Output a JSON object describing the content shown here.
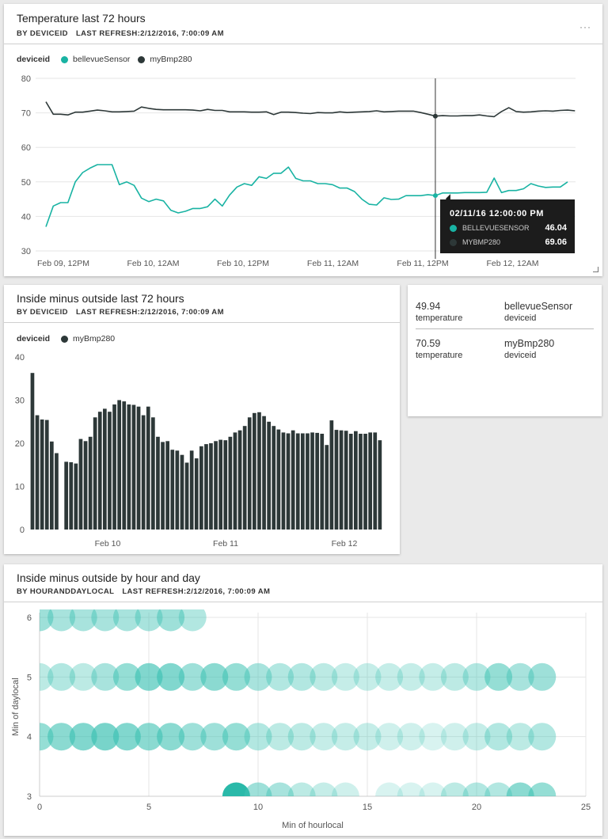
{
  "colors": {
    "teal": "#19b3a3",
    "dark": "#2d3838",
    "bubble": "#3ec2b3"
  },
  "tile1": {
    "title": "Temperature last 72 hours",
    "by": "BY DEVICEID",
    "refresh": "LAST REFRESH:2/12/2016, 7:00:09 AM",
    "more_icon": "···",
    "legend_label": "deviceid",
    "legend_items": [
      "bellevueSensor",
      "myBmp280"
    ],
    "tooltip": {
      "title": "02/11/16 12:00:00 PM",
      "rows": [
        {
          "name": "BELLEVUESENSOR",
          "value": "46.04"
        },
        {
          "name": "MYBMP280",
          "value": "69.06"
        }
      ]
    }
  },
  "tile2": {
    "title": "Inside minus outside last 72 hours",
    "by": "BY DEVICEID",
    "refresh": "LAST REFRESH:2/12/2016, 7:00:09 AM",
    "legend_label": "deviceid",
    "legend_items": [
      "myBmp280"
    ]
  },
  "tile3": {
    "rows": [
      {
        "value": "49.94",
        "value_label": "temperature",
        "name": "bellevueSensor",
        "name_label": "deviceid"
      },
      {
        "value": "70.59",
        "value_label": "temperature",
        "name": "myBmp280",
        "name_label": "deviceid"
      }
    ]
  },
  "tile4": {
    "title": "Inside minus outside by hour and day",
    "by": "BY HOURANDDAYLOCAL",
    "refresh": "LAST REFRESH:2/12/2016, 7:00:09 AM"
  },
  "chart_data": [
    {
      "type": "line",
      "title": "Temperature last 72 hours",
      "xlabel": "",
      "ylabel": "",
      "ylim": [
        30,
        80
      ],
      "yticks": [
        30,
        40,
        50,
        60,
        70,
        80
      ],
      "x_tick_labels": [
        "Feb 09, 12PM",
        "Feb 10, 12AM",
        "Feb 10, 12PM",
        "Feb 11, 12AM",
        "Feb 11, 12PM",
        "Feb 12, 12AM"
      ],
      "grid": true,
      "hover_index": 53,
      "series": [
        {
          "name": "bellevueSensor",
          "values": [
            37,
            43,
            44,
            44,
            50,
            52.7,
            54,
            55,
            55,
            55,
            49.2,
            50,
            49,
            45.3,
            44.3,
            45,
            44.5,
            41.8,
            41,
            41.5,
            42.3,
            42.3,
            42.8,
            45,
            43,
            46.2,
            48.5,
            49.5,
            49,
            51.5,
            51,
            52.5,
            52.5,
            54.3,
            51,
            50.3,
            50.3,
            49.5,
            49.5,
            49.2,
            48.2,
            48.2,
            47.2,
            45,
            43.5,
            43.3,
            45.4,
            44.9,
            45,
            46,
            46,
            46,
            46.3,
            46.04,
            46.8,
            46.8,
            46.8,
            46.9,
            46.9,
            46.9,
            47,
            51.1,
            46.9,
            47.5,
            47.5,
            48,
            49.5,
            48.8,
            48.4,
            48.5,
            48.5,
            50
          ]
        },
        {
          "name": "myBmp280",
          "values": [
            73.2,
            69.6,
            69.6,
            69.4,
            70.2,
            70.2,
            70.5,
            70.8,
            70.6,
            70.3,
            70.3,
            70.4,
            70.5,
            71.7,
            71.3,
            71,
            70.9,
            70.9,
            70.9,
            70.9,
            70.8,
            70.6,
            71,
            70.7,
            70.7,
            70.3,
            70.3,
            70.3,
            70.2,
            70.2,
            70.3,
            69.5,
            70.2,
            70.2,
            70.1,
            69.9,
            69.8,
            70.1,
            70,
            70,
            70.3,
            70.1,
            70.2,
            70.3,
            70.4,
            70.6,
            70.3,
            70.4,
            70.5,
            70.5,
            70.5,
            70.1,
            69.6,
            69.06,
            69.2,
            69.1,
            69.1,
            69.2,
            69.2,
            69.4,
            69.1,
            68.9,
            70.4,
            71.5,
            70.4,
            70.2,
            70.3,
            70.5,
            70.6,
            70.5,
            70.7,
            70.8,
            70.6
          ]
        }
      ]
    },
    {
      "type": "bar",
      "title": "Inside minus outside last 72 hours",
      "xlabel": "",
      "ylabel": "",
      "ylim": [
        0,
        40
      ],
      "yticks": [
        0,
        10,
        20,
        30,
        40
      ],
      "x_tick_labels": [
        "Feb 10",
        "Feb 11",
        "Feb 12"
      ],
      "series": [
        {
          "name": "myBmp280",
          "values": [
            36.3,
            26.5,
            25.5,
            25.4,
            20.4,
            17.7,
            null,
            15.7,
            15.6,
            15.3,
            21,
            20.5,
            21.5,
            26,
            27.3,
            28,
            27.3,
            29,
            30,
            29.7,
            29,
            28.9,
            28.5,
            26.5,
            28.5,
            26,
            21.5,
            20.3,
            20.5,
            18.5,
            18.3,
            17.3,
            15.5,
            18.3,
            16.5,
            19.3,
            19.8,
            20,
            20.5,
            20.8,
            20.7,
            21.5,
            22.5,
            23,
            24,
            26,
            27,
            27.2,
            26.3,
            25,
            24,
            23.2,
            22.5,
            22.3,
            23,
            22.3,
            22.3,
            22.3,
            22.5,
            22.4,
            22.2,
            19.6,
            25.3,
            23.1,
            23,
            22.9,
            22.2,
            22.8,
            22.2,
            22.2,
            22.5,
            22.5,
            20.7
          ]
        }
      ]
    },
    {
      "type": "scatter",
      "title": "",
      "xlabel": "Min of hourlocal",
      "ylabel": "Min of daylocal",
      "xlim": [
        0,
        25
      ],
      "ylim": [
        3,
        6
      ],
      "xticks": [
        0,
        5,
        10,
        15,
        20,
        25
      ],
      "yticks": [
        3,
        4,
        5,
        6
      ],
      "grid": true,
      "points": [
        {
          "x": 0,
          "y": 6,
          "o": 0.5
        },
        {
          "x": 1,
          "y": 6,
          "o": 0.45
        },
        {
          "x": 2,
          "y": 6,
          "o": 0.45
        },
        {
          "x": 3,
          "y": 6,
          "o": 0.45
        },
        {
          "x": 4,
          "y": 6,
          "o": 0.45
        },
        {
          "x": 5,
          "y": 6,
          "o": 0.45
        },
        {
          "x": 6,
          "y": 6,
          "o": 0.5
        },
        {
          "x": 7,
          "y": 6,
          "o": 0.4
        },
        {
          "x": 0,
          "y": 5,
          "o": 0.35
        },
        {
          "x": 1,
          "y": 5,
          "o": 0.4
        },
        {
          "x": 2,
          "y": 5,
          "o": 0.35
        },
        {
          "x": 3,
          "y": 5,
          "o": 0.45
        },
        {
          "x": 4,
          "y": 5,
          "o": 0.55
        },
        {
          "x": 5,
          "y": 5,
          "o": 0.65
        },
        {
          "x": 6,
          "y": 5,
          "o": 0.65
        },
        {
          "x": 7,
          "y": 5,
          "o": 0.5
        },
        {
          "x": 8,
          "y": 5,
          "o": 0.6
        },
        {
          "x": 9,
          "y": 5,
          "o": 0.55
        },
        {
          "x": 10,
          "y": 5,
          "o": 0.45
        },
        {
          "x": 11,
          "y": 5,
          "o": 0.4
        },
        {
          "x": 12,
          "y": 5,
          "o": 0.4
        },
        {
          "x": 13,
          "y": 5,
          "o": 0.35
        },
        {
          "x": 14,
          "y": 5,
          "o": 0.3
        },
        {
          "x": 15,
          "y": 5,
          "o": 0.3
        },
        {
          "x": 16,
          "y": 5,
          "o": 0.3
        },
        {
          "x": 17,
          "y": 5,
          "o": 0.3
        },
        {
          "x": 18,
          "y": 5,
          "o": 0.3
        },
        {
          "x": 19,
          "y": 5,
          "o": 0.35
        },
        {
          "x": 20,
          "y": 5,
          "o": 0.4
        },
        {
          "x": 21,
          "y": 5,
          "o": 0.55
        },
        {
          "x": 22,
          "y": 5,
          "o": 0.45
        },
        {
          "x": 23,
          "y": 5,
          "o": 0.5
        },
        {
          "x": 0,
          "y": 4,
          "o": 0.55
        },
        {
          "x": 1,
          "y": 4,
          "o": 0.6
        },
        {
          "x": 2,
          "y": 4,
          "o": 0.65
        },
        {
          "x": 3,
          "y": 4,
          "o": 0.7
        },
        {
          "x": 4,
          "y": 4,
          "o": 0.65
        },
        {
          "x": 5,
          "y": 4,
          "o": 0.6
        },
        {
          "x": 6,
          "y": 4,
          "o": 0.6
        },
        {
          "x": 7,
          "y": 4,
          "o": 0.5
        },
        {
          "x": 8,
          "y": 4,
          "o": 0.5
        },
        {
          "x": 9,
          "y": 4,
          "o": 0.55
        },
        {
          "x": 10,
          "y": 4,
          "o": 0.4
        },
        {
          "x": 11,
          "y": 4,
          "o": 0.35
        },
        {
          "x": 12,
          "y": 4,
          "o": 0.35
        },
        {
          "x": 13,
          "y": 4,
          "o": 0.3
        },
        {
          "x": 14,
          "y": 4,
          "o": 0.3
        },
        {
          "x": 15,
          "y": 4,
          "o": 0.3
        },
        {
          "x": 16,
          "y": 4,
          "o": 0.25
        },
        {
          "x": 17,
          "y": 4,
          "o": 0.25
        },
        {
          "x": 18,
          "y": 4,
          "o": 0.2
        },
        {
          "x": 19,
          "y": 4,
          "o": 0.25
        },
        {
          "x": 20,
          "y": 4,
          "o": 0.3
        },
        {
          "x": 21,
          "y": 4,
          "o": 0.4
        },
        {
          "x": 22,
          "y": 4,
          "o": 0.35
        },
        {
          "x": 23,
          "y": 4,
          "o": 0.4
        },
        {
          "x": 9,
          "y": 3,
          "o": 0.95
        },
        {
          "x": 10,
          "y": 3,
          "o": 0.5
        },
        {
          "x": 11,
          "y": 3,
          "o": 0.45
        },
        {
          "x": 12,
          "y": 3,
          "o": 0.35
        },
        {
          "x": 13,
          "y": 3,
          "o": 0.3
        },
        {
          "x": 14,
          "y": 3,
          "o": 0.25
        },
        {
          "x": 16,
          "y": 3,
          "o": 0.2
        },
        {
          "x": 17,
          "y": 3,
          "o": 0.2
        },
        {
          "x": 18,
          "y": 3,
          "o": 0.2
        },
        {
          "x": 19,
          "y": 3,
          "o": 0.35
        },
        {
          "x": 20,
          "y": 3,
          "o": 0.4
        },
        {
          "x": 21,
          "y": 3,
          "o": 0.4
        },
        {
          "x": 22,
          "y": 3,
          "o": 0.6
        },
        {
          "x": 23,
          "y": 3,
          "o": 0.55
        }
      ]
    }
  ]
}
